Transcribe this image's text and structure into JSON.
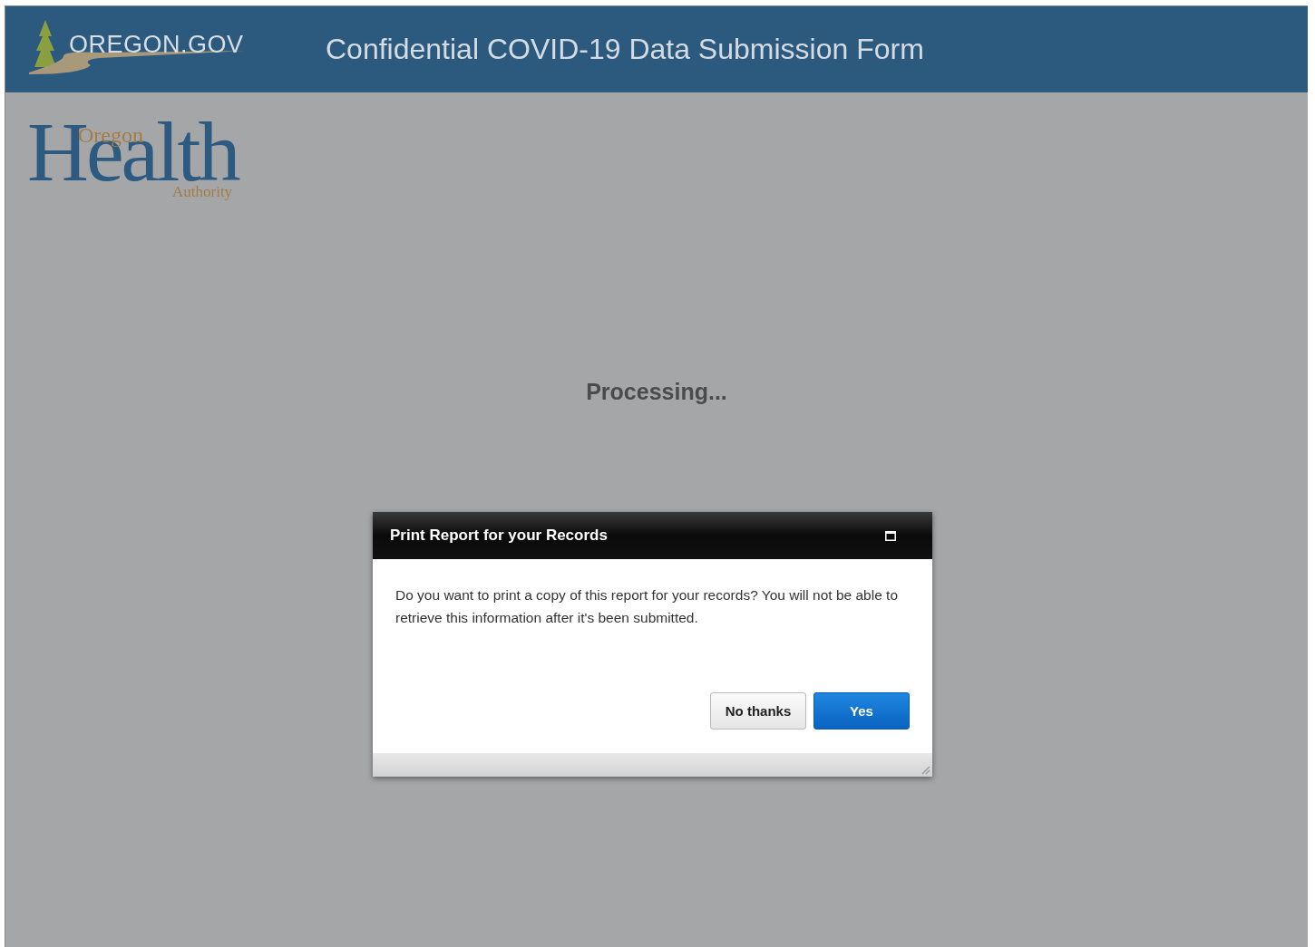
{
  "header": {
    "logo_text": "OREGON.GOV",
    "title": "Confidential COVID-19 Data Submission Form"
  },
  "agency_logo": {
    "small_top": "Oregon",
    "main": "Health",
    "small_bottom": "Authority"
  },
  "status": "Processing...",
  "dialog": {
    "title": "Print Report for your Records",
    "message": "Do you want to print a copy of this report for your records? You will not be able to retrieve this information after it's been submitted.",
    "buttons": [
      {
        "label": "No thanks",
        "kind": "secondary"
      },
      {
        "label": "Yes",
        "kind": "primary"
      }
    ]
  }
}
